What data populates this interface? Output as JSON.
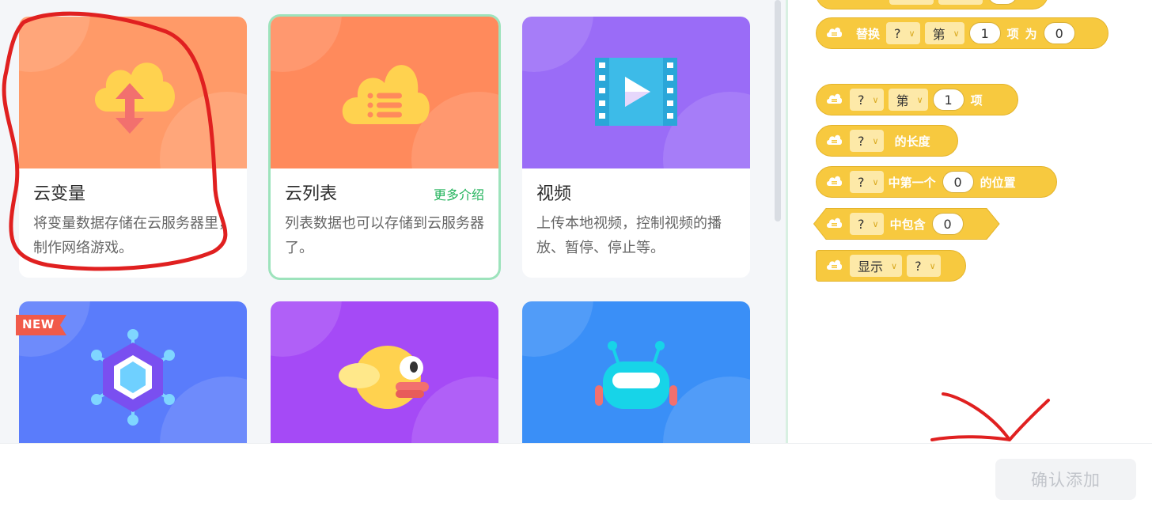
{
  "extensions": [
    {
      "title": "云变量",
      "desc": "将变量数据存储在云服务器里，制作网络游戏。",
      "color": "#ff9a68",
      "icon": "cloud-upload-download-icon"
    },
    {
      "title": "云列表",
      "more_link": "更多介绍",
      "desc": "列表数据也可以存储到云服务器了。",
      "color": "#ff8a5c",
      "icon": "cloud-list-icon",
      "selected": true
    },
    {
      "title": "视频",
      "desc": "上传本地视频，控制视频的播放、暂停、停止等。",
      "color": "#9a6cf7",
      "icon": "video-play-icon"
    },
    {
      "badge": "NEW",
      "color": "#5a7cfb",
      "icon": "hexagon-network-icon"
    },
    {
      "color": "#a54af6",
      "icon": "bird-icon"
    },
    {
      "color": "#3a8ff7",
      "icon": "robot-icon"
    }
  ],
  "blocks": {
    "replace": {
      "word1": "替换",
      "dd1": "?",
      "dd2": "第",
      "num1": "1",
      "word2": "项",
      "word3": "为",
      "val": "0"
    },
    "item": {
      "dd1": "?",
      "dd2": "第",
      "num": "1",
      "word": "项"
    },
    "length": {
      "dd": "?",
      "word": "的长度"
    },
    "index_of": {
      "dd": "?",
      "word1": "中第一个",
      "val": "0",
      "word2": "的位置"
    },
    "contains": {
      "dd": "?",
      "word": "中包含",
      "val": "0"
    },
    "show": {
      "dd1": "显示",
      "dd2": "?"
    }
  },
  "footer": {
    "confirm_label": "确认添加"
  }
}
